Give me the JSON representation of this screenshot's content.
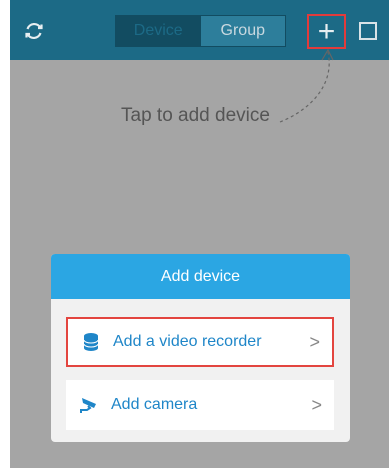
{
  "header": {
    "refresh_icon": "refresh-icon",
    "tabs": [
      {
        "label": "Device",
        "selected": true
      },
      {
        "label": "Group",
        "selected": false
      }
    ],
    "add_icon": "plus-icon",
    "square_icon": "square-icon",
    "highlight_color": "#e23b3b"
  },
  "hint": {
    "text": "Tap to add device"
  },
  "dialog": {
    "title": "Add device",
    "options": [
      {
        "label": "Add a video recorder",
        "icon": "database-icon",
        "chevron": ">"
      },
      {
        "label": "Add camera",
        "icon": "camera-icon",
        "chevron": ">"
      }
    ],
    "accent_color": "#2ba6e3"
  }
}
